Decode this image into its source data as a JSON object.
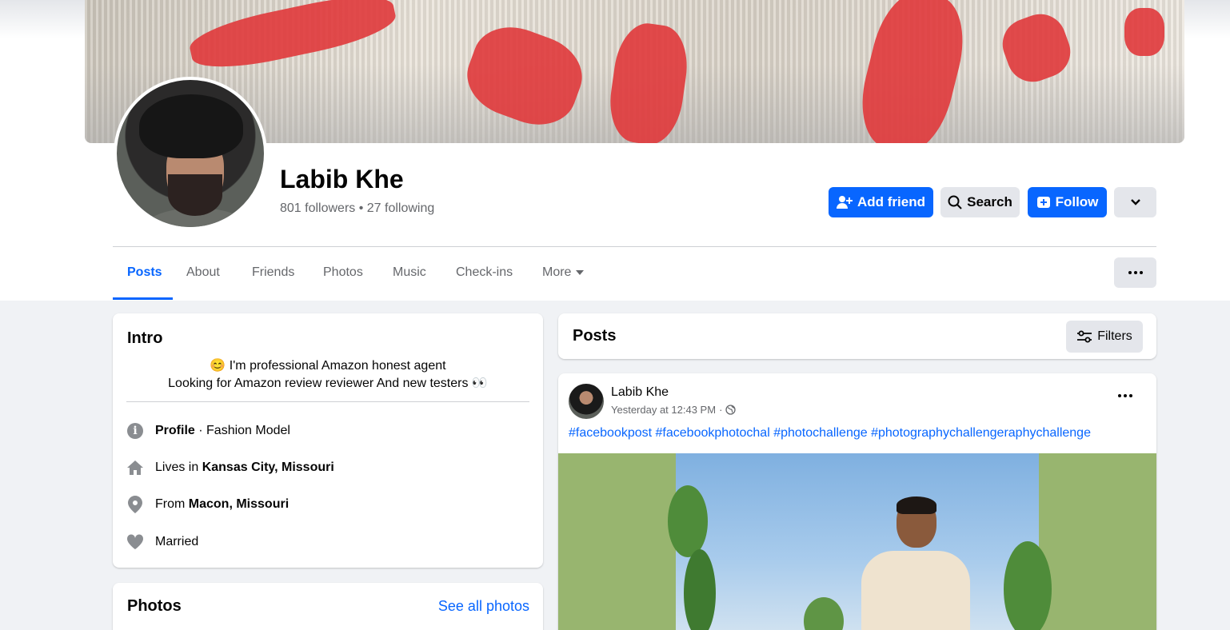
{
  "profile": {
    "name": "Labib Khe",
    "stats": "801 followers • 27 following"
  },
  "actions": {
    "add_friend": "Add friend",
    "search": "Search",
    "follow": "Follow"
  },
  "tabs": [
    {
      "label": "Posts",
      "active": true
    },
    {
      "label": "About"
    },
    {
      "label": "Friends"
    },
    {
      "label": "Photos"
    },
    {
      "label": "Music"
    },
    {
      "label": "Check-ins"
    },
    {
      "label": "More"
    }
  ],
  "intro": {
    "title": "Intro",
    "bio_line1": "😊 I'm professional Amazon honest agent",
    "bio_line2": "Looking for Amazon review reviewer And new testers 👀",
    "profile_label": "Profile",
    "profile_value": " · Fashion Model",
    "lives_prefix": "Lives in ",
    "lives_value": "Kansas City, Missouri",
    "from_prefix": "From ",
    "from_value": "Macon, Missouri",
    "relationship": "Married"
  },
  "photos": {
    "title": "Photos",
    "see_all": "See all photos"
  },
  "posts_header": {
    "title": "Posts",
    "filters": "Filters"
  },
  "post": {
    "author": "Labib Khe",
    "time": "Yesterday at 12:43 PM",
    "separator": "·",
    "tags": "#facebookpost #facebookphotochal #photochallenge #photographychallengeraphychallenge"
  },
  "colors": {
    "accent": "#0866ff",
    "background": "#f0f2f5",
    "secondary_text": "#65676b"
  }
}
